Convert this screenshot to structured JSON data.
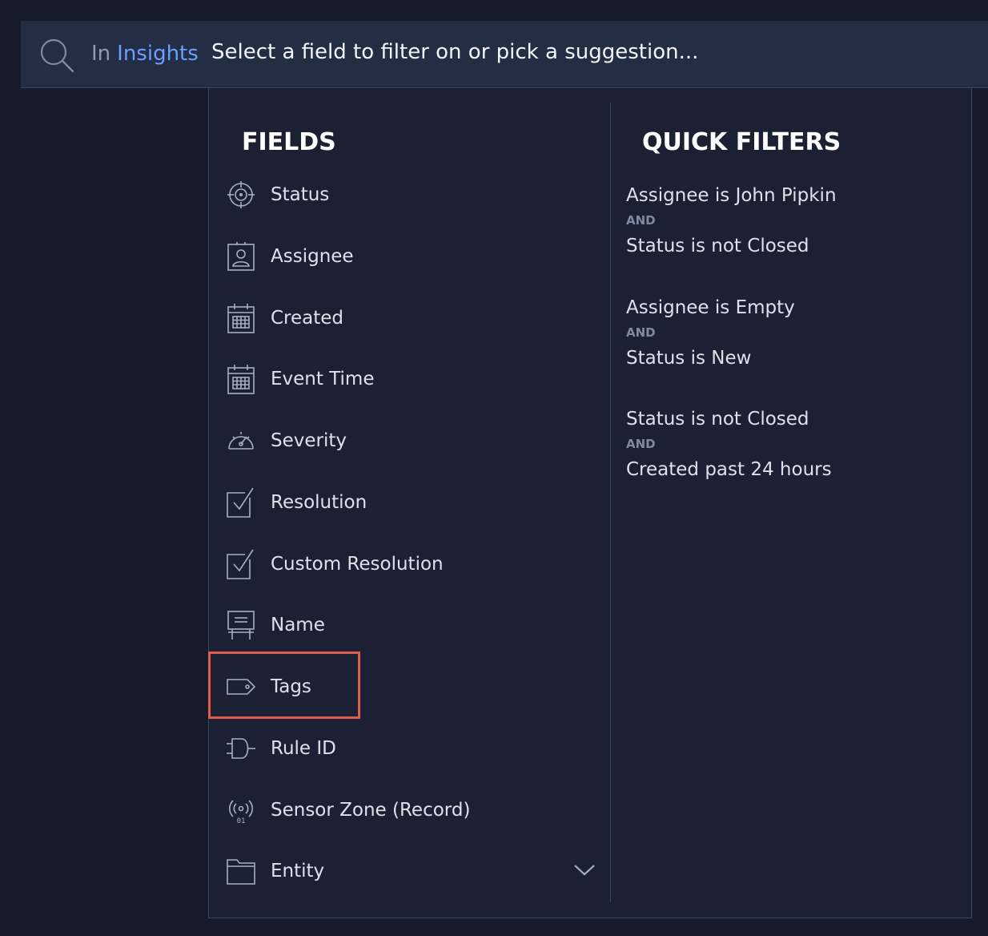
{
  "search": {
    "prefix": "In",
    "scope": "Insights",
    "placeholder": "Select a field to filter on or pick a suggestion..."
  },
  "fields": {
    "title": "FIELDS",
    "items": [
      {
        "label": "Status",
        "icon": "target-icon"
      },
      {
        "label": "Assignee",
        "icon": "user-card-icon"
      },
      {
        "label": "Created",
        "icon": "calendar-icon"
      },
      {
        "label": "Event Time",
        "icon": "calendar-icon"
      },
      {
        "label": "Severity",
        "icon": "gauge-icon"
      },
      {
        "label": "Resolution",
        "icon": "checked-document-icon"
      },
      {
        "label": "Custom Resolution",
        "icon": "checked-document-icon"
      },
      {
        "label": "Name",
        "icon": "easel-sign-icon"
      },
      {
        "label": "Tags",
        "icon": "tag-icon",
        "highlighted": true
      },
      {
        "label": "Rule ID",
        "icon": "logic-gate-icon"
      },
      {
        "label": "Sensor Zone (Record)",
        "icon": "sensor-icon"
      },
      {
        "label": "Entity",
        "icon": "folder-icon"
      }
    ]
  },
  "quick_filters": {
    "title": "QUICK FILTERS",
    "items": [
      {
        "first": "Assignee is John Pipkin",
        "joiner": "AND",
        "second": "Status is not Closed"
      },
      {
        "first": "Assignee is Empty",
        "joiner": "AND",
        "second": "Status is New"
      },
      {
        "first": "Status is not Closed",
        "joiner": "AND",
        "second": "Created past 24 hours"
      }
    ]
  },
  "colors": {
    "page_background": "#151b28",
    "search_background": "#232e44",
    "panel_background": "#1b2132",
    "link_accent": "#6d9eff",
    "highlight": "#e25a4b"
  }
}
